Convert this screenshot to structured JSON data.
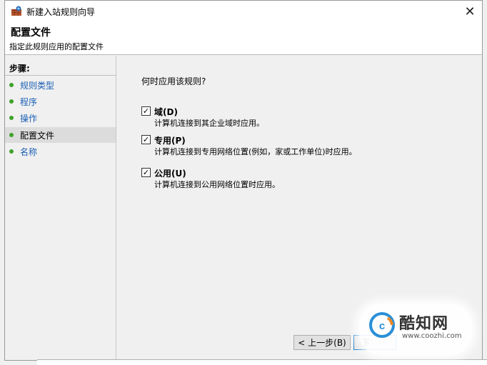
{
  "window": {
    "title": "新建入站规则向导",
    "close_glyph": "✕"
  },
  "header": {
    "title": "配置文件",
    "subtitle": "指定此规则应用的配置文件"
  },
  "sidebar": {
    "heading": "步骤:",
    "items": [
      {
        "label": "规则类型"
      },
      {
        "label": "程序"
      },
      {
        "label": "操作"
      },
      {
        "label": "配置文件"
      },
      {
        "label": "名称"
      }
    ]
  },
  "main": {
    "question": "何时应用该规则?",
    "options": [
      {
        "label": "域(D)",
        "checked": true,
        "description": "计算机连接到其企业域时应用。"
      },
      {
        "label": "专用(P)",
        "checked": true,
        "description": "计算机连接到专用网络位置(例如，家或工作单位)时应用。"
      },
      {
        "label": "公用(U)",
        "checked": true,
        "description": "计算机连接到公用网络位置时应用。"
      }
    ]
  },
  "buttons": {
    "back": "< 上一步(B)",
    "next": "下"
  },
  "watermark": {
    "name": "酷知网",
    "url": "www.coozhi.com"
  },
  "colors": {
    "step_link": "#1a5fb4",
    "step_dot": "#3fa12a",
    "accent": "#0078d7"
  }
}
